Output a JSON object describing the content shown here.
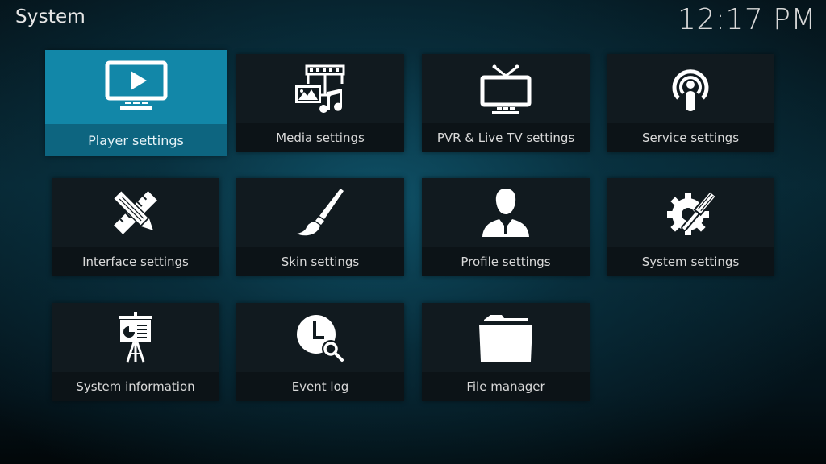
{
  "header": {
    "title": "System",
    "clock": "12:17 PM"
  },
  "colors": {
    "focus": "#1287a8",
    "tile": "#111a1f",
    "tile_label_bg": "#0c1317"
  },
  "tiles": [
    {
      "label": "Player settings",
      "icon": "tv-play-icon",
      "focused": true
    },
    {
      "label": "Media settings",
      "icon": "media-icon",
      "focused": false
    },
    {
      "label": "PVR & Live TV settings",
      "icon": "tv-antenna-icon",
      "focused": false
    },
    {
      "label": "Service settings",
      "icon": "podcast-broadcast-icon",
      "focused": false
    },
    {
      "label": "Interface settings",
      "icon": "pencil-ruler-icon",
      "focused": false
    },
    {
      "label": "Skin settings",
      "icon": "paintbrush-icon",
      "focused": false
    },
    {
      "label": "Profile settings",
      "icon": "user-profile-icon",
      "focused": false
    },
    {
      "label": "System settings",
      "icon": "gear-wrench-icon",
      "focused": false
    },
    {
      "label": "System information",
      "icon": "presentation-board-icon",
      "focused": false
    },
    {
      "label": "Event log",
      "icon": "clock-search-icon",
      "focused": false
    },
    {
      "label": "File manager",
      "icon": "folder-icon",
      "focused": false
    }
  ]
}
